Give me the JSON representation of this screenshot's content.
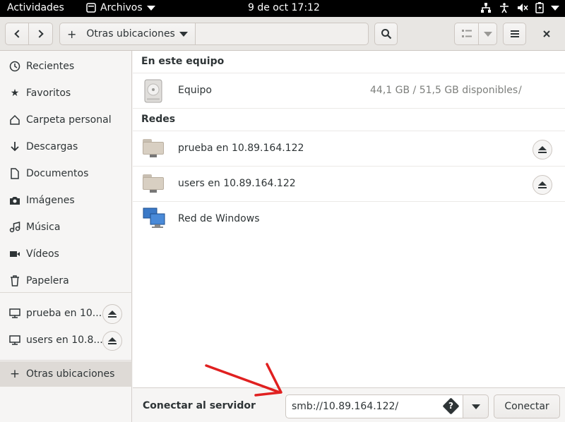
{
  "topbar": {
    "activities": "Actividades",
    "app_name": "Archivos",
    "clock": "9 de oct  17:12"
  },
  "header": {
    "back_icon": "chevron-left-icon",
    "forward_icon": "chevron-right-icon",
    "path_prefix": "+",
    "path_label": "Otras ubicaciones",
    "search_icon": "search-icon",
    "view_icon": "list-view-icon",
    "menu_icon": "hamburger-menu-icon",
    "close_icon": "close-icon"
  },
  "sidebar": {
    "items": [
      {
        "label": "Recientes",
        "icon": "clock-icon"
      },
      {
        "label": "Favoritos",
        "icon": "star-icon"
      },
      {
        "label": "Carpeta personal",
        "icon": "home-icon"
      },
      {
        "label": "Descargas",
        "icon": "download-icon"
      },
      {
        "label": "Documentos",
        "icon": "document-icon"
      },
      {
        "label": "Imágenes",
        "icon": "camera-icon"
      },
      {
        "label": "Música",
        "icon": "music-icon"
      },
      {
        "label": "Vídeos",
        "icon": "video-icon"
      },
      {
        "label": "Papelera",
        "icon": "trash-icon"
      }
    ],
    "mounts": [
      {
        "label": "prueba en 10....",
        "icon": "network-drive-icon"
      },
      {
        "label": "users en 10.8...",
        "icon": "network-drive-icon"
      }
    ],
    "other": {
      "label": "Otras ubicaciones",
      "prefix": "+"
    }
  },
  "main": {
    "this_computer": {
      "heading": "En este equipo",
      "item": {
        "name": "Equipo",
        "space": "44,1 GB / 51,5 GB disponibles",
        "path": "/"
      }
    },
    "networks": {
      "heading": "Redes",
      "items": [
        {
          "name": "prueba en 10.89.164.122",
          "icon": "network-folder-icon"
        },
        {
          "name": "users en 10.89.164.122",
          "icon": "network-folder-icon"
        },
        {
          "name": "Red de Windows",
          "icon": "windows-network-icon"
        }
      ]
    }
  },
  "connect": {
    "label": "Conectar al servidor",
    "server_value": "smb://10.89.164.122/",
    "button": "Conectar"
  },
  "colors": {
    "annotation_arrow": "#e02020",
    "topbar_bg": "#000000"
  }
}
